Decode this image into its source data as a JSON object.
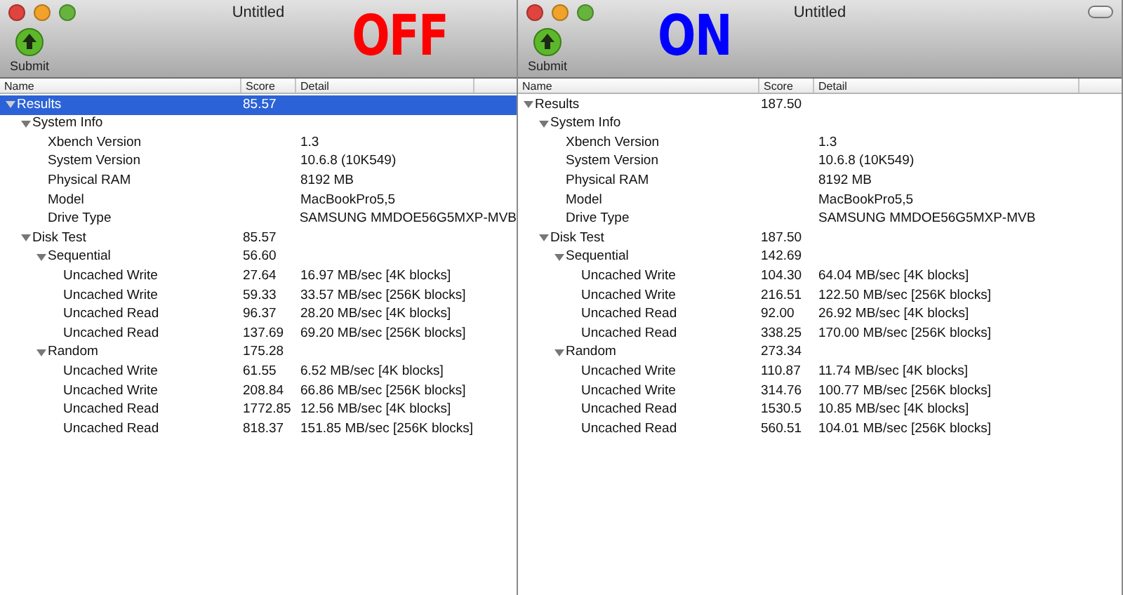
{
  "windows": [
    {
      "title": "Untitled",
      "overlay_label": {
        "text": "OFF",
        "color": "#ff0000"
      },
      "toolbar_toggle": false,
      "toolbar_button": "Submit",
      "columns": [
        "Name",
        "Score",
        "Detail"
      ],
      "rows": [
        {
          "name": "Results",
          "score": "85.57",
          "selected": true,
          "expanded": true,
          "children": [
            {
              "name": "System Info",
              "selected": false,
              "expanded": true,
              "children": [
                {
                  "name": "Xbench Version",
                  "detail": "1.3",
                  "selected": false
                },
                {
                  "name": "System Version",
                  "detail": "10.6.8 (10K549)",
                  "selected": false
                },
                {
                  "name": "Physical RAM",
                  "detail": "8192 MB",
                  "selected": false
                },
                {
                  "name": "Model",
                  "detail": "MacBookPro5,5",
                  "selected": false
                },
                {
                  "name": "Drive Type",
                  "detail": "SAMSUNG MMDOE56G5MXP-MVB",
                  "selected": false
                }
              ]
            },
            {
              "name": "Disk Test",
              "score": "85.57",
              "selected": false,
              "expanded": true,
              "children": [
                {
                  "name": "Sequential",
                  "score": "56.60",
                  "selected": false,
                  "expanded": true,
                  "children": [
                    {
                      "name": "Uncached Write",
                      "score": "27.64",
                      "detail": "16.97 MB/sec [4K blocks]",
                      "selected": false
                    },
                    {
                      "name": "Uncached Write",
                      "score": "59.33",
                      "detail": "33.57 MB/sec [256K blocks]",
                      "selected": false
                    },
                    {
                      "name": "Uncached Read",
                      "score": "96.37",
                      "detail": "28.20 MB/sec [4K blocks]",
                      "selected": false
                    },
                    {
                      "name": "Uncached Read",
                      "score": "137.69",
                      "detail": "69.20 MB/sec [256K blocks]",
                      "selected": false
                    }
                  ]
                },
                {
                  "name": "Random",
                  "score": "175.28",
                  "selected": false,
                  "expanded": true,
                  "children": [
                    {
                      "name": "Uncached Write",
                      "score": "61.55",
                      "detail": "6.52 MB/sec [4K blocks]",
                      "selected": false
                    },
                    {
                      "name": "Uncached Write",
                      "score": "208.84",
                      "detail": "66.86 MB/sec [256K blocks]",
                      "selected": false
                    },
                    {
                      "name": "Uncached Read",
                      "score": "1772.85",
                      "detail": "12.56 MB/sec [4K blocks]",
                      "selected": false
                    },
                    {
                      "name": "Uncached Read",
                      "score": "818.37",
                      "detail": "151.85 MB/sec [256K blocks]",
                      "selected": false
                    }
                  ]
                }
              ]
            }
          ]
        }
      ]
    },
    {
      "title": "Untitled",
      "overlay_label": {
        "text": "ON",
        "color": "#0000ff"
      },
      "toolbar_toggle": true,
      "toolbar_button": "Submit",
      "columns": [
        "Name",
        "Score",
        "Detail"
      ],
      "rows": [
        {
          "name": "Results",
          "score": "187.50",
          "selected": false,
          "expanded": true,
          "children": [
            {
              "name": "System Info",
              "selected": false,
              "expanded": true,
              "children": [
                {
                  "name": "Xbench Version",
                  "detail": "1.3",
                  "selected": false
                },
                {
                  "name": "System Version",
                  "detail": "10.6.8 (10K549)",
                  "selected": false
                },
                {
                  "name": "Physical RAM",
                  "detail": "8192 MB",
                  "selected": false
                },
                {
                  "name": "Model",
                  "detail": "MacBookPro5,5",
                  "selected": false
                },
                {
                  "name": "Drive Type",
                  "detail": "SAMSUNG MMDOE56G5MXP-MVB",
                  "selected": false
                }
              ]
            },
            {
              "name": "Disk Test",
              "score": "187.50",
              "selected": false,
              "expanded": true,
              "children": [
                {
                  "name": "Sequential",
                  "score": "142.69",
                  "selected": false,
                  "expanded": true,
                  "children": [
                    {
                      "name": "Uncached Write",
                      "score": "104.30",
                      "detail": "64.04 MB/sec [4K blocks]",
                      "selected": false
                    },
                    {
                      "name": "Uncached Write",
                      "score": "216.51",
                      "detail": "122.50 MB/sec [256K blocks]",
                      "selected": false
                    },
                    {
                      "name": "Uncached Read",
                      "score": "92.00",
                      "detail": "26.92 MB/sec [4K blocks]",
                      "selected": false
                    },
                    {
                      "name": "Uncached Read",
                      "score": "338.25",
                      "detail": "170.00 MB/sec [256K blocks]",
                      "selected": false
                    }
                  ]
                },
                {
                  "name": "Random",
                  "score": "273.34",
                  "selected": false,
                  "expanded": true,
                  "children": [
                    {
                      "name": "Uncached Write",
                      "score": "110.87",
                      "detail": "11.74 MB/sec [4K blocks]",
                      "selected": false
                    },
                    {
                      "name": "Uncached Write",
                      "score": "314.76",
                      "detail": "100.77 MB/sec [256K blocks]",
                      "selected": false
                    },
                    {
                      "name": "Uncached Read",
                      "score": "1530.5",
                      "detail": "10.85 MB/sec [4K blocks]",
                      "selected": false
                    },
                    {
                      "name": "Uncached Read",
                      "score": "560.51",
                      "detail": "104.01 MB/sec [256K blocks]",
                      "selected": false
                    }
                  ]
                }
              ]
            }
          ]
        }
      ]
    }
  ]
}
